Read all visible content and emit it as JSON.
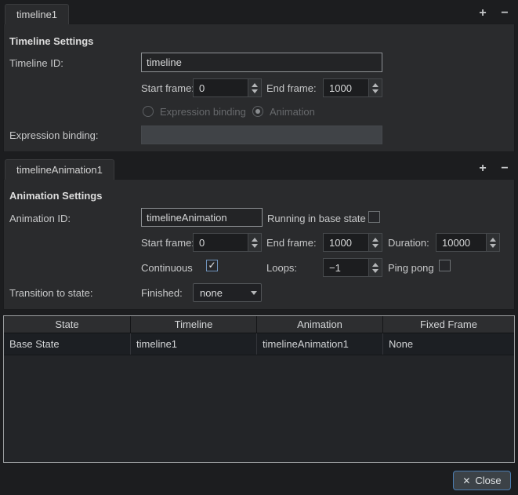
{
  "timeline_section": {
    "tab": "timeline1",
    "add_button": "+",
    "remove_button": "−",
    "title": "Timeline Settings",
    "timeline_id_label": "Timeline ID:",
    "timeline_id_value": "timeline",
    "start_frame_label": "Start frame:",
    "start_frame_value": "0",
    "end_frame_label": "End frame:",
    "end_frame_value": "1000",
    "expression_binding_radio_label": "Expression binding",
    "animation_radio_label": "Animation",
    "expression_binding_label": "Expression binding:",
    "expression_binding_value": ""
  },
  "animation_section": {
    "tab": "timelineAnimation1",
    "add_button": "+",
    "remove_button": "−",
    "title": "Animation Settings",
    "animation_id_label": "Animation ID:",
    "animation_id_value": "timelineAnimation",
    "running_in_base_state_label": "Running in base state",
    "start_frame_label": "Start frame:",
    "start_frame_value": "0",
    "end_frame_label": "End frame:",
    "end_frame_value": "1000",
    "duration_label": "Duration:",
    "duration_value": "10000",
    "continuous_label": "Continuous",
    "continuous_check_glyph": "✓",
    "loops_label": "Loops:",
    "loops_value": "−1",
    "ping_pong_label": "Ping pong",
    "transition_label": "Transition to state:",
    "finished_label": "Finished:",
    "finished_value": "none"
  },
  "states_table": {
    "headers": [
      "State",
      "Timeline",
      "Animation",
      "Fixed Frame"
    ],
    "rows": [
      [
        "Base State",
        "timeline1",
        "timelineAnimation1",
        "None"
      ]
    ]
  },
  "footer": {
    "close_icon": "✕",
    "close_label": "Close"
  },
  "colors": {
    "window_bg": "#1c1d1f",
    "pane_bg": "#2a2b2d",
    "field_bg": "#232426",
    "close_border": "#4b7cb0",
    "text": "#cfcfcf"
  }
}
